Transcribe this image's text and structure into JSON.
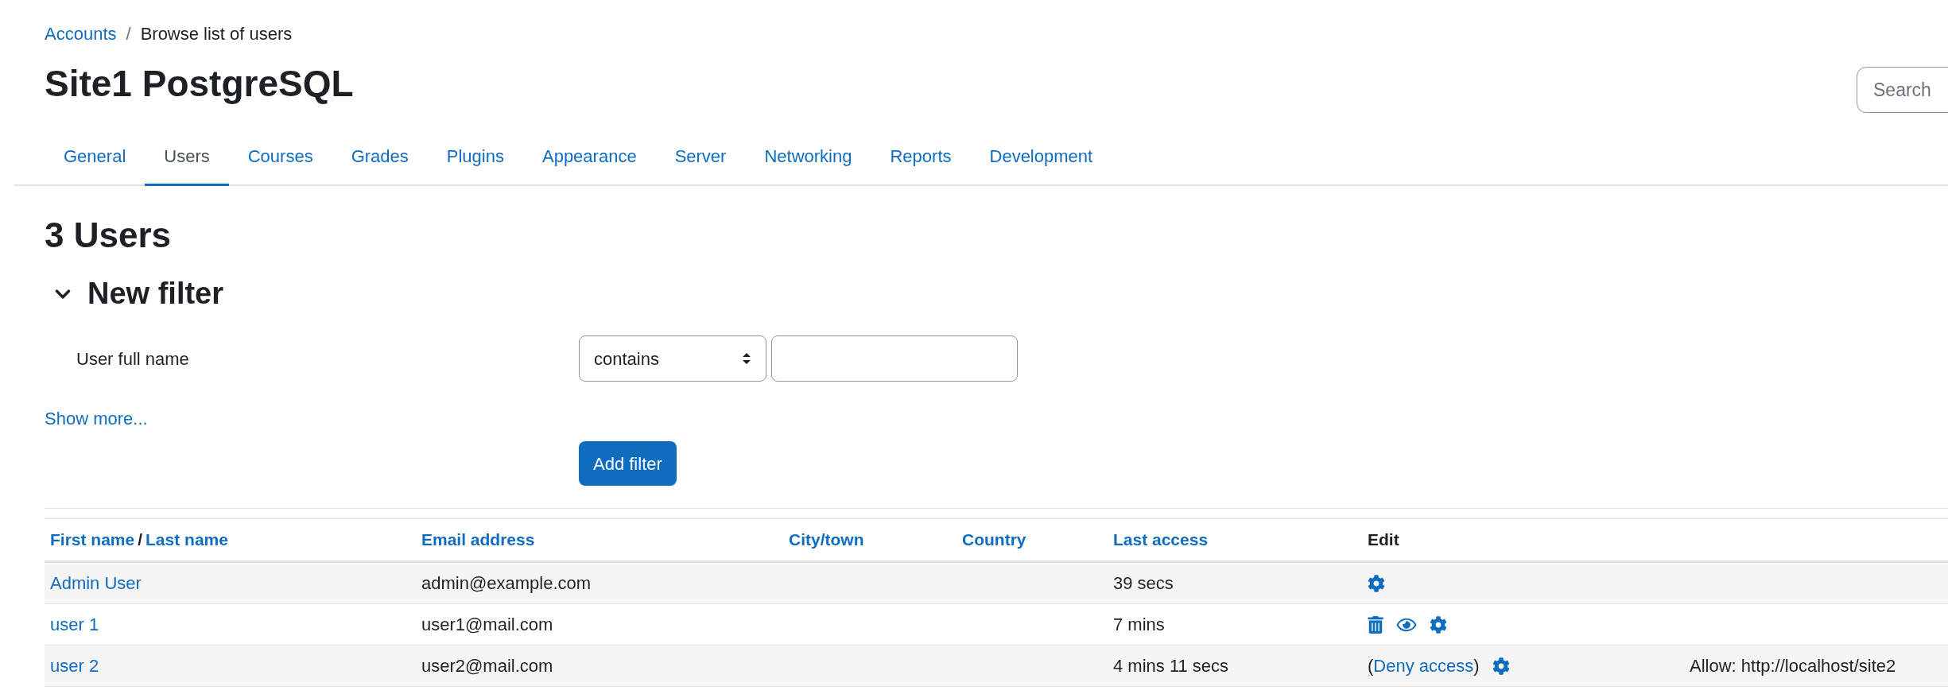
{
  "breadcrumb_separator": "/",
  "breadcrumb": [
    {
      "label": "Accounts",
      "kind": "link"
    },
    {
      "label": "Browse list of users",
      "kind": "text"
    }
  ],
  "page_title": "Site1 PostgreSQL",
  "search": {
    "placeholder": "Search"
  },
  "tabs": [
    {
      "label": "General",
      "selected": false
    },
    {
      "label": "Users",
      "selected": true
    },
    {
      "label": "Courses",
      "selected": false
    },
    {
      "label": "Grades",
      "selected": false
    },
    {
      "label": "Plugins",
      "selected": false
    },
    {
      "label": "Appearance",
      "selected": false
    },
    {
      "label": "Server",
      "selected": false
    },
    {
      "label": "Networking",
      "selected": false
    },
    {
      "label": "Reports",
      "selected": false
    },
    {
      "label": "Development",
      "selected": false
    }
  ],
  "heading": "3 Users",
  "filter": {
    "title": "New filter",
    "expanded": true,
    "label": "User full name",
    "operator": "contains",
    "show_more": "Show more...",
    "button": "Add filter"
  },
  "table": {
    "columns": [
      {
        "kind": "sort_pair",
        "labels": [
          "First name",
          "Last name"
        ],
        "separator": "/"
      },
      {
        "kind": "sort",
        "label": "Email address"
      },
      {
        "kind": "sort",
        "label": "City/town"
      },
      {
        "kind": "sort",
        "label": "Country"
      },
      {
        "kind": "sort",
        "label": "Last access"
      },
      {
        "kind": "text",
        "label": "Edit"
      }
    ],
    "rows": [
      {
        "name": "Admin User",
        "email": "admin@example.com",
        "last_access": "39 secs",
        "edit": [
          {
            "kind": "settings"
          }
        ]
      },
      {
        "name": "user 1",
        "email": "user1@mail.com",
        "last_access": "7 mins",
        "edit": [
          {
            "kind": "delete"
          },
          {
            "kind": "view"
          },
          {
            "kind": "settings"
          }
        ]
      },
      {
        "name": "user 2",
        "email": "user2@mail.com",
        "last_access": "4 mins 11 secs",
        "edit": [
          {
            "kind": "link",
            "open": "(",
            "text": "Deny access",
            "close": ")"
          },
          {
            "kind": "settings"
          }
        ],
        "column_7": "Allow: http://localhost/site2"
      }
    ]
  }
}
